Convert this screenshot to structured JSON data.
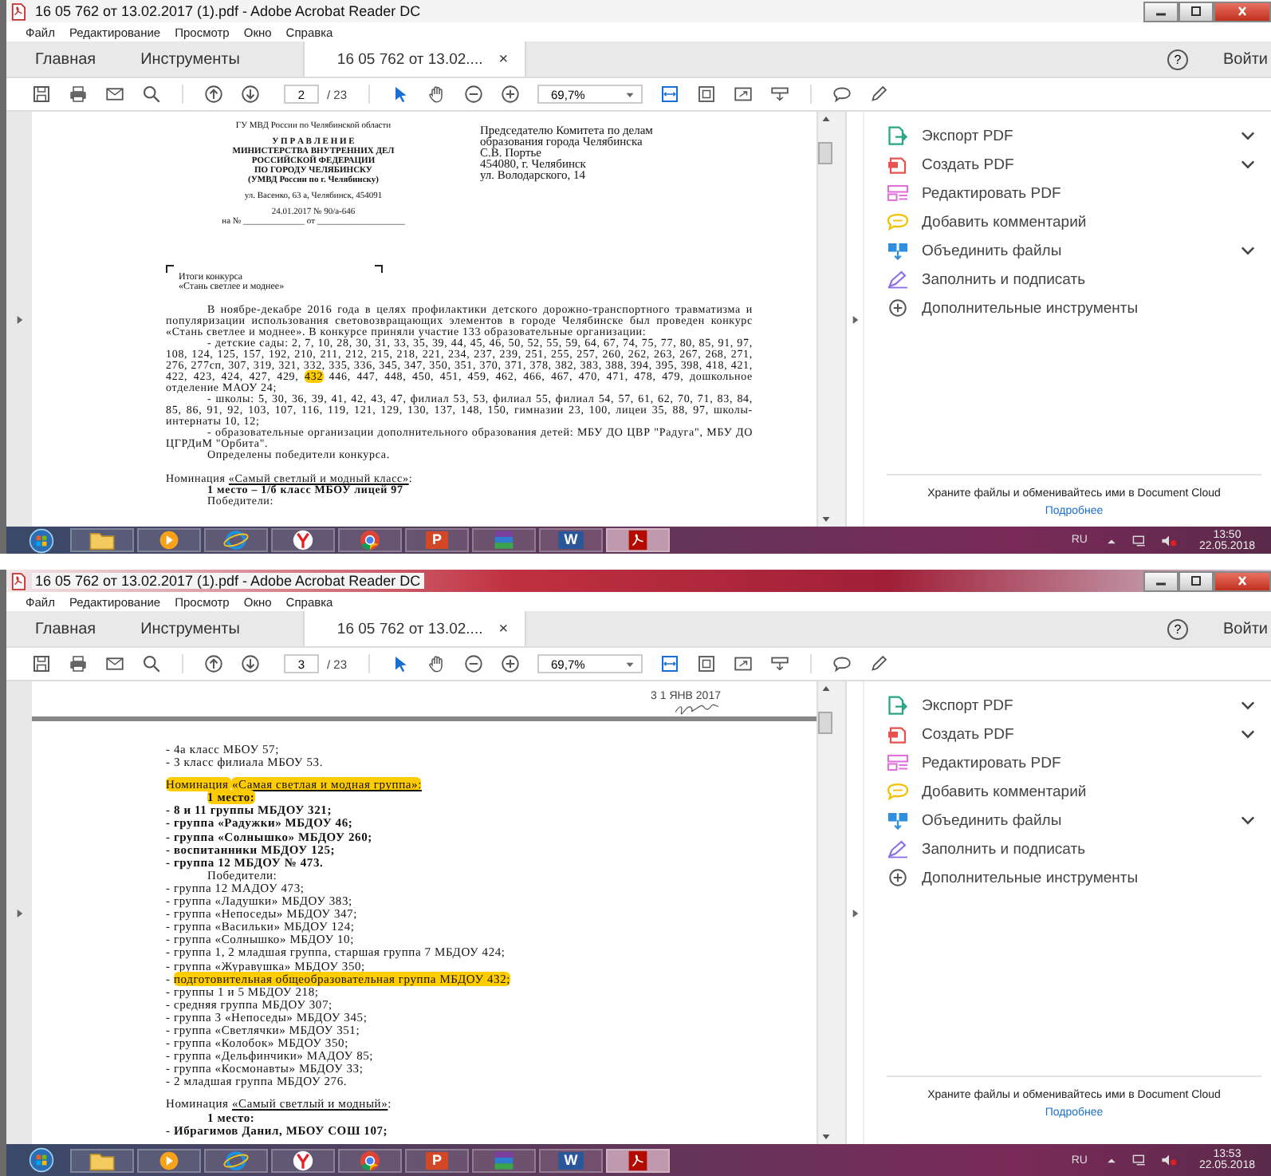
{
  "windows": [
    {
      "title": "16 05 762 от 13.02.2017 (1).pdf - Adobe Acrobat Reader DC",
      "active": false,
      "menu": [
        "Файл",
        "Редактирование",
        "Просмотр",
        "Окно",
        "Справка"
      ],
      "tabs": [
        {
          "label": "Главная",
          "selected": false
        },
        {
          "label": "Инструменты",
          "selected": false
        },
        {
          "label": "16 05 762 от 13.02....",
          "selected": true,
          "close": "×"
        }
      ],
      "help": "?",
      "signin": "Войти",
      "toolbar": {
        "page": "2",
        "total": "/ 23",
        "zoom": "69,7%"
      },
      "document": {
        "blocks": [
          {
            "kind": "letterhead",
            "left": [
              {
                "lines": [
                  {
                    "text": "ГУ МВД России по Челябинской области",
                    "bold": false
                  }
                ]
              },
              {
                "lines": [
                  {
                    "text": "У П Р А В Л Е Н И Е",
                    "bold": true
                  },
                  {
                    "text": "МИНИСТЕРСТВА   ВНУТРЕННИХ  ДЕЛ",
                    "bold": true
                  },
                  {
                    "text": "РОССИЙСКОЙ ФЕДЕРАЦИИ",
                    "bold": true
                  },
                  {
                    "text": "ПО ГОРОДУ ЧЕЛЯБИНСКУ",
                    "bold": true
                  },
                  {
                    "text": "(УМВД России по г. Челябинску)",
                    "bold": true
                  }
                ]
              },
              {
                "lines": [
                  {
                    "text": "ул. Васенко, 63 а, Челябинск, 454091",
                    "bold": false
                  }
                ]
              },
              {
                "lines": [
                  {
                    "text": "24.01.2017  №  90/а-646",
                    "bold": false
                  },
                  {
                    "text": "на № ______________ от ____________________",
                    "bold": false
                  }
                ]
              }
            ],
            "right": [
              "Председателю Комитета по делам",
              "образования города Челябинска",
              "С.В. Портье",
              "454080, г. Челябинск",
              "ул. Володарского, 14"
            ]
          },
          {
            "kind": "brackets"
          },
          {
            "kind": "subject",
            "segments": [
              {
                "text": "Итоги конкурса"
              }
            ]
          },
          {
            "kind": "subject",
            "segments": [
              {
                "text": "«Стань светлее и моднее»"
              }
            ]
          },
          {
            "kind": "gap"
          },
          {
            "kind": "text",
            "wrap": true,
            "indent": true,
            "bold": false,
            "segments": [
              {
                "text": "В ноябре-декабре 2016 года в целях профилактики детского дорожно-транспортного травматизма и популяризации использования световозвращающих элементов в городе Челябинске был проведен конкурс «Стань светлее и моднее». В конкурсе приняли участие 133 образовательные организации:"
              }
            ]
          },
          {
            "kind": "text",
            "wrap": true,
            "indent": true,
            "bold": false,
            "segments": [
              {
                "text": "- детские сады: 2, 7, 10, 28, 30, 31, 33, 35, 39, 44, 45, 46, 50, 52, 55, 59, 64, 67, 74, 75, 77, 80, 85, 91, 97, 108, 124, 125, 157, 192, 210, 211, 212, 215, 218, 221, 234, 237, 239, 251, 255, 257, 260, 262, 263, 267, 268, 271, 276, 277сп, 307, 319, 321, 332, 335, 336, 345, 347, 350, 351, 370, 371, 378, 382, 383, 388, 394, 395, 398, 418, 421, 422, 423, 424, 427, 429, "
              },
              {
                "text": "432",
                "highlight": true
              },
              {
                "text": " 446, 447, 448, 450, 451, 459, 462, 466, 467, 470, 471, 478, 479, дошкольное отделение МАОУ 24;"
              }
            ]
          },
          {
            "kind": "text",
            "wrap": true,
            "indent": true,
            "bold": false,
            "segments": [
              {
                "text": "- школы: 5, 30, 36, 39, 41, 42, 43, 47, филиал 53, 53, филиал 55, филиал 54, 57, 61, 62, 70, 71, 83, 84, 85, 86, 91, 92, 103, 107, 116, 119, 121, 129, 130, 137, 148, 150, гимназии 23, 100, лицеи 35, 88, 97, школы-интернаты 10, 12;"
              }
            ]
          },
          {
            "kind": "text",
            "wrap": true,
            "indent": true,
            "bold": false,
            "segments": [
              {
                "text": "- образовательные организации дополнительного образования детей: МБУ ДО ЦВР \"Радуга\", МБУ ДО ЦГРДиМ \"Орбита\"."
              }
            ]
          },
          {
            "kind": "text",
            "wrap": false,
            "indent": true,
            "bold": false,
            "segments": [
              {
                "text": "Определены победители конкурса."
              }
            ]
          },
          {
            "kind": "gap"
          },
          {
            "kind": "text",
            "wrap": false,
            "indent": false,
            "bold": false,
            "segments": [
              {
                "text": "Номинация "
              },
              {
                "text": "«Самый светлый и модный класс»",
                "underline": true
              },
              {
                "text": ":"
              }
            ]
          },
          {
            "kind": "text",
            "wrap": false,
            "indent": true,
            "bold": true,
            "segments": [
              {
                "text": "1 место – 1/б класс МБОУ лицей 97"
              }
            ]
          },
          {
            "kind": "text",
            "wrap": false,
            "indent": true,
            "bold": false,
            "segments": [
              {
                "text": "Победители:"
              }
            ]
          }
        ]
      },
      "tools": [
        {
          "kind": "export",
          "label": "Экспорт PDF",
          "color": "#27a584",
          "expandable": true
        },
        {
          "kind": "create",
          "label": "Создать PDF",
          "color": "#e8514d",
          "expandable": true
        },
        {
          "kind": "edit",
          "label": "Редактировать PDF",
          "color": "#e36fdb",
          "expandable": false
        },
        {
          "kind": "comment",
          "label": "Добавить комментарий",
          "color": "#f2c200",
          "expandable": false
        },
        {
          "kind": "combine",
          "label": "Объединить файлы",
          "color": "#2d8fdd",
          "expandable": true
        },
        {
          "kind": "sign",
          "label": "Заполнить и подписать",
          "color": "#8a6de9",
          "expandable": false
        },
        {
          "kind": "more",
          "label": "Дополнительные инструменты",
          "color": "#555555",
          "expandable": false
        }
      ],
      "promo": {
        "text": "Храните файлы и обменивайтесь ими в Document Cloud",
        "link": "Подробнее"
      },
      "taskbar": {
        "apps": [
          {
            "kind": "explorer",
            "selected": false
          },
          {
            "kind": "media",
            "selected": false
          },
          {
            "kind": "ie",
            "selected": false
          },
          {
            "kind": "yandex",
            "selected": false
          },
          {
            "kind": "chrome",
            "selected": false
          },
          {
            "kind": "powerpoint",
            "letter": "P",
            "selected": false
          },
          {
            "kind": "winrar",
            "selected": false
          },
          {
            "kind": "word",
            "letter": "W",
            "selected": false
          },
          {
            "kind": "acrobat",
            "selected": true
          }
        ],
        "language": "RU",
        "time": "13:50",
        "date": "22.05.2018"
      }
    },
    {
      "title": "16 05 762 от 13.02.2017 (1).pdf - Adobe Acrobat Reader DC",
      "active": true,
      "menu": [
        "Файл",
        "Редактирование",
        "Просмотр",
        "Окно",
        "Справка"
      ],
      "tabs": [
        {
          "label": "Главная",
          "selected": false
        },
        {
          "label": "Инструменты",
          "selected": false
        },
        {
          "label": "16 05 762 от 13.02....",
          "selected": true,
          "close": "×"
        }
      ],
      "help": "?",
      "signin": "Войти",
      "toolbar": {
        "page": "3",
        "total": "/ 23",
        "zoom": "69,7%"
      },
      "document": {
        "blocks": [
          {
            "kind": "stamp",
            "text": "3 1 ЯНВ 2017"
          },
          {
            "kind": "page-break"
          },
          {
            "kind": "text",
            "wrap": false,
            "indent": false,
            "bold": false,
            "segments": [
              {
                "text": "- 4а класс МБОУ 57;"
              }
            ]
          },
          {
            "kind": "text",
            "wrap": false,
            "indent": false,
            "bold": false,
            "segments": [
              {
                "text": "- 3 класс филиала МБОУ 53."
              }
            ]
          },
          {
            "kind": "gap"
          },
          {
            "kind": "text",
            "wrap": false,
            "indent": false,
            "bold": false,
            "segments": [
              {
                "text": "Номинация ",
                "highlight": true
              },
              {
                "text": "«Самая светлая и модная группа»:",
                "highlight": true,
                "underline": true
              }
            ]
          },
          {
            "kind": "text",
            "wrap": false,
            "indent": true,
            "bold": true,
            "segments": [
              {
                "text": "1 место:",
                "highlight": true
              }
            ]
          },
          {
            "kind": "text",
            "wrap": false,
            "indent": false,
            "bold": true,
            "segments": [
              {
                "text": "- 8 и 11 группы МБДОУ 321;"
              }
            ]
          },
          {
            "kind": "text",
            "wrap": false,
            "indent": false,
            "bold": true,
            "segments": [
              {
                "text": "- группа «Радужки» МБДОУ 46;"
              }
            ]
          },
          {
            "kind": "text",
            "wrap": false,
            "indent": false,
            "bold": true,
            "segments": [
              {
                "text": "- группа «Солнышко» МБДОУ 260;"
              }
            ]
          },
          {
            "kind": "text",
            "wrap": false,
            "indent": false,
            "bold": true,
            "segments": [
              {
                "text": "- воспитанники МБДОУ 125;"
              }
            ]
          },
          {
            "kind": "text",
            "wrap": false,
            "indent": false,
            "bold": true,
            "segments": [
              {
                "text": "- группа 12 МБДОУ № 473."
              }
            ]
          },
          {
            "kind": "text",
            "wrap": false,
            "indent": true,
            "bold": false,
            "segments": [
              {
                "text": "Победители:"
              }
            ]
          },
          {
            "kind": "text",
            "wrap": false,
            "indent": false,
            "bold": false,
            "segments": [
              {
                "text": "- группа 12 МАДОУ 473;"
              }
            ]
          },
          {
            "kind": "text",
            "wrap": false,
            "indent": false,
            "bold": false,
            "segments": [
              {
                "text": "- группа «Ладушки» МБДОУ 383;"
              }
            ]
          },
          {
            "kind": "text",
            "wrap": false,
            "indent": false,
            "bold": false,
            "segments": [
              {
                "text": "- группа «Непоседы» МБДОУ 347;"
              }
            ]
          },
          {
            "kind": "text",
            "wrap": false,
            "indent": false,
            "bold": false,
            "segments": [
              {
                "text": "- группа «Васильки» МБДОУ 124;"
              }
            ]
          },
          {
            "kind": "text",
            "wrap": false,
            "indent": false,
            "bold": false,
            "segments": [
              {
                "text": "- группа «Солнышко» МБДОУ 10;"
              }
            ]
          },
          {
            "kind": "text",
            "wrap": false,
            "indent": false,
            "bold": false,
            "segments": [
              {
                "text": "- группа 1, 2 младшая группа, старшая группа 7 МБДОУ 424;"
              }
            ]
          },
          {
            "kind": "text",
            "wrap": false,
            "indent": false,
            "bold": false,
            "segments": [
              {
                "text": "- группа «Журавушка» МБДОУ 350;"
              }
            ]
          },
          {
            "kind": "text",
            "wrap": false,
            "indent": false,
            "bold": false,
            "segments": [
              {
                "text": "- "
              },
              {
                "text": "подготовительная общеобразовательная группа МБДОУ 432;",
                "highlight": true
              }
            ]
          },
          {
            "kind": "text",
            "wrap": false,
            "indent": false,
            "bold": false,
            "segments": [
              {
                "text": "- группы 1 и 5 МБДОУ 218;"
              }
            ]
          },
          {
            "kind": "text",
            "wrap": false,
            "indent": false,
            "bold": false,
            "segments": [
              {
                "text": "- средняя группа МБДОУ 307;"
              }
            ]
          },
          {
            "kind": "text",
            "wrap": false,
            "indent": false,
            "bold": false,
            "segments": [
              {
                "text": "- группа 3 «Непоседы» МБДОУ 345;"
              }
            ]
          },
          {
            "kind": "text",
            "wrap": false,
            "indent": false,
            "bold": false,
            "segments": [
              {
                "text": "- группа «Светлячки» МБДОУ 351;"
              }
            ]
          },
          {
            "kind": "text",
            "wrap": false,
            "indent": false,
            "bold": false,
            "segments": [
              {
                "text": "- группа «Колобок» МБДОУ 350;"
              }
            ]
          },
          {
            "kind": "text",
            "wrap": false,
            "indent": false,
            "bold": false,
            "segments": [
              {
                "text": "- группа «Дельфинчики» МАДОУ 85;"
              }
            ]
          },
          {
            "kind": "text",
            "wrap": false,
            "indent": false,
            "bold": false,
            "segments": [
              {
                "text": "- группа «Космонавты» МБДОУ 33;"
              }
            ]
          },
          {
            "kind": "text",
            "wrap": false,
            "indent": false,
            "bold": false,
            "segments": [
              {
                "text": "- 2 младшая группа МБДОУ 276."
              }
            ]
          },
          {
            "kind": "gap"
          },
          {
            "kind": "text",
            "wrap": false,
            "indent": false,
            "bold": false,
            "segments": [
              {
                "text": " Номинация "
              },
              {
                "text": "«Самый светлый и модный»",
                "underline": true
              },
              {
                "text": ":"
              }
            ]
          },
          {
            "kind": "text",
            "wrap": false,
            "indent": true,
            "bold": true,
            "segments": [
              {
                "text": "1 место:"
              }
            ]
          },
          {
            "kind": "text",
            "wrap": false,
            "indent": false,
            "bold": true,
            "segments": [
              {
                "text": "- Ибрагимов Данил, МБОУ СОШ 107;"
              }
            ]
          }
        ]
      },
      "tools": [
        {
          "kind": "export",
          "label": "Экспорт PDF",
          "color": "#27a584",
          "expandable": true
        },
        {
          "kind": "create",
          "label": "Создать PDF",
          "color": "#e8514d",
          "expandable": true
        },
        {
          "kind": "edit",
          "label": "Редактировать PDF",
          "color": "#e36fdb",
          "expandable": false
        },
        {
          "kind": "comment",
          "label": "Добавить комментарий",
          "color": "#f2c200",
          "expandable": false
        },
        {
          "kind": "combine",
          "label": "Объединить файлы",
          "color": "#2d8fdd",
          "expandable": true
        },
        {
          "kind": "sign",
          "label": "Заполнить и подписать",
          "color": "#8a6de9",
          "expandable": false
        },
        {
          "kind": "more",
          "label": "Дополнительные инструменты",
          "color": "#555555",
          "expandable": false
        }
      ],
      "promo": {
        "text": "Храните файлы и обменивайтесь ими в Document Cloud",
        "link": "Подробнее"
      },
      "taskbar": {
        "apps": [
          {
            "kind": "explorer",
            "selected": false
          },
          {
            "kind": "media",
            "selected": false
          },
          {
            "kind": "ie",
            "selected": false
          },
          {
            "kind": "yandex",
            "selected": false
          },
          {
            "kind": "chrome",
            "selected": false
          },
          {
            "kind": "powerpoint",
            "letter": "P",
            "selected": false
          },
          {
            "kind": "winrar",
            "selected": false
          },
          {
            "kind": "word",
            "letter": "W",
            "selected": false
          },
          {
            "kind": "acrobat",
            "selected": true
          }
        ],
        "language": "RU",
        "time": "13:53",
        "date": "22.05.2018"
      }
    }
  ]
}
